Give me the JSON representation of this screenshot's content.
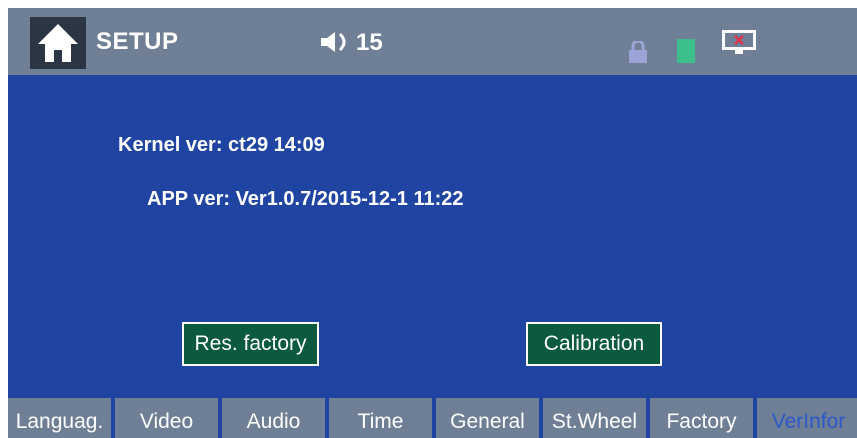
{
  "header": {
    "title": "SETUP",
    "volume": "15",
    "icons": {
      "home": "home-icon",
      "speaker": "speaker-icon",
      "lock": "lock-icon",
      "battery": "battery-icon",
      "screen_off": "screen-off-icon"
    }
  },
  "info": {
    "kernel": "Kernel ver: ct29 14:09",
    "app": "APP ver: Ver1.0.7/2015-12-1 11:22"
  },
  "buttons": {
    "res_factory": "Res. factory",
    "calibration": "Calibration"
  },
  "tabs": [
    {
      "label": "Languag.",
      "active": false
    },
    {
      "label": "Video",
      "active": false
    },
    {
      "label": "Audio",
      "active": false
    },
    {
      "label": "Time",
      "active": false
    },
    {
      "label": "General",
      "active": false
    },
    {
      "label": "St.Wheel",
      "active": false
    },
    {
      "label": "Factory",
      "active": false
    },
    {
      "label": "VerInfor",
      "active": true
    }
  ],
  "colors": {
    "background": "#1f44a1",
    "bar": "#6f7f95",
    "button": "#0b5a3f",
    "active_tab_text": "#2e58c8"
  }
}
